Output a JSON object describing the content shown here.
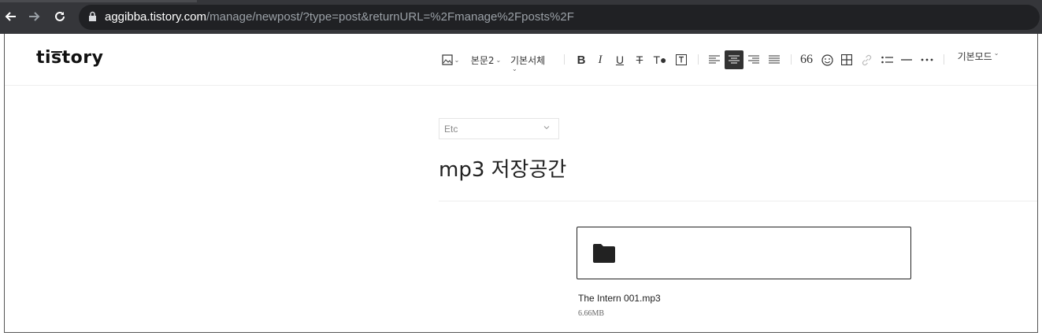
{
  "browser": {
    "url_host": "aggibba.tistory.com",
    "url_path": "/manage/newpost/?type=post&returnURL=%2Fmanage%2Fposts%2F",
    "icons": [
      "back-arrow-icon",
      "forward-arrow-icon",
      "reload-icon",
      "lock-icon"
    ]
  },
  "header": {
    "logo": "tistory",
    "toolbar": {
      "paragraph_style": "본문2",
      "font_family": "기본서체",
      "mode": "기본모드"
    }
  },
  "post": {
    "category": "Etc",
    "title": "mp3 저장공간"
  },
  "attachment": {
    "file_name": "The Intern 001.mp3",
    "file_size": "6.66MB"
  },
  "colors": {
    "chrome_bg": "#35363a",
    "omnibox_bg": "#202124",
    "active_button": "#333333"
  }
}
